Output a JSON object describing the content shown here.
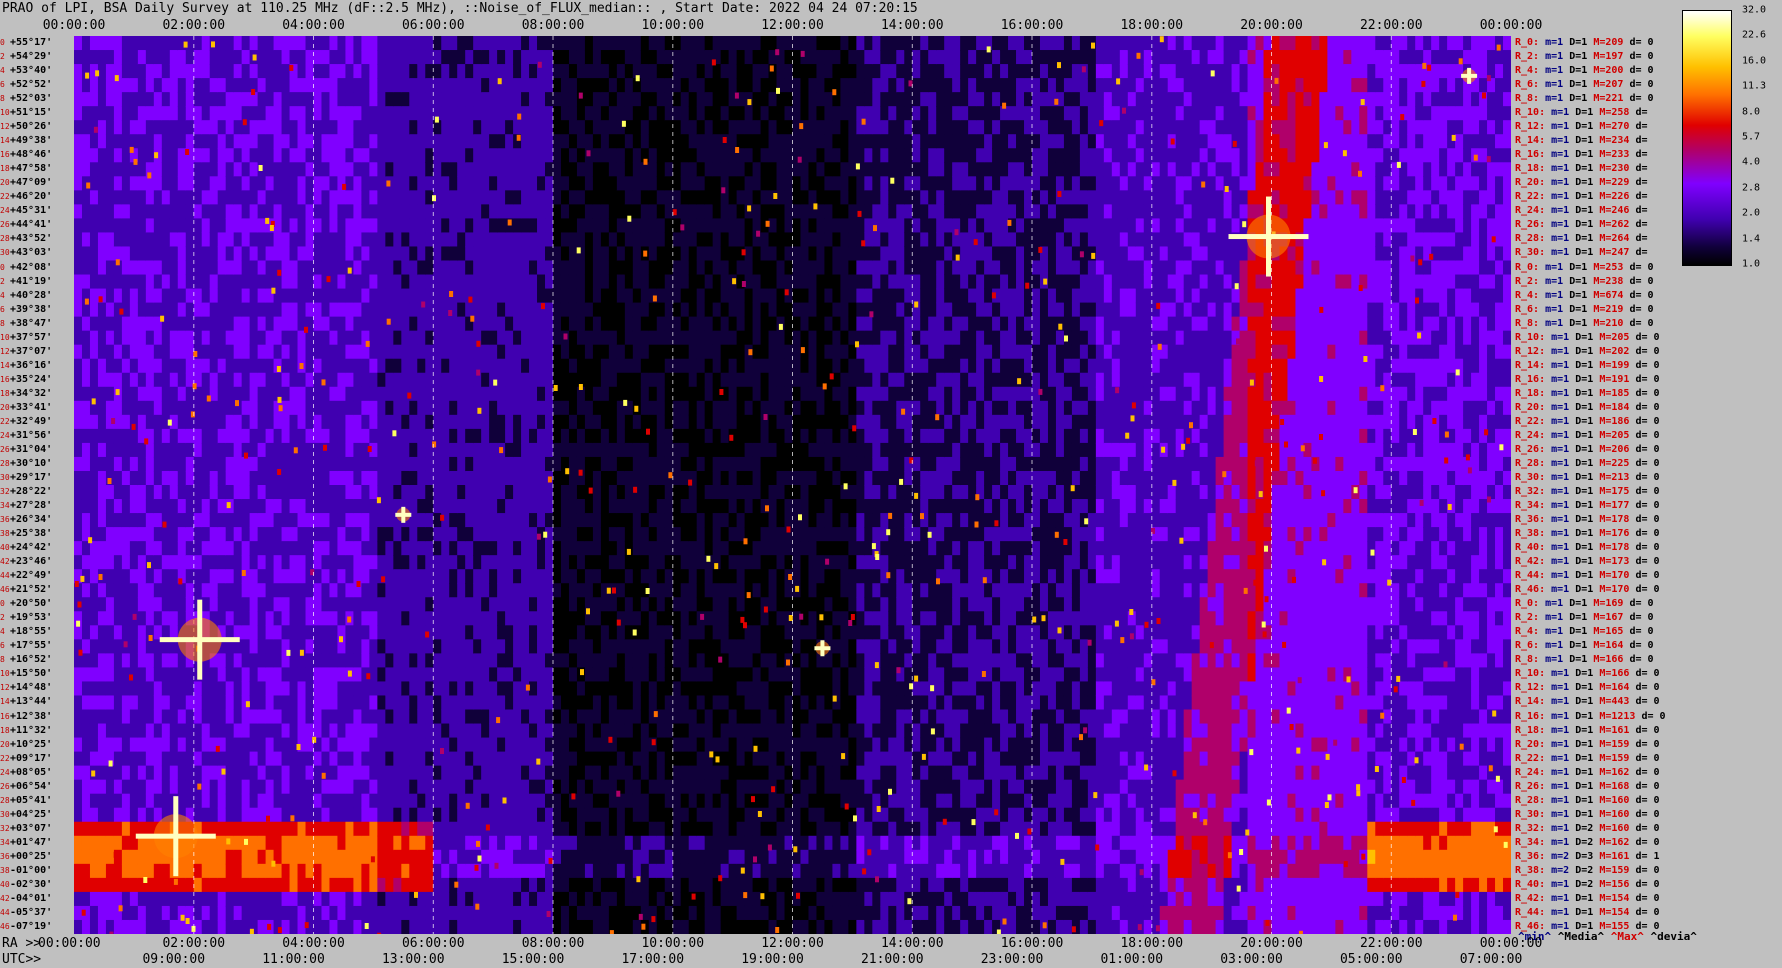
{
  "title": "PRAO of LPI, BSA Daily Survey at 110.25 MHz (dF::2.5 MHz), ::Noise_of_FLUX_median:: , Start Date: 2022 04 24 07:20:15",
  "top_axis_ticks": [
    "00:00:00",
    "02:00:00",
    "04:00:00",
    "06:00:00",
    "08:00:00",
    "10:00:00",
    "12:00:00",
    "14:00:00",
    "16:00:00",
    "18:00:00",
    "20:00:00",
    "22:00:00",
    "00:00:00"
  ],
  "bottom_ra": {
    "prefix": "RA >>",
    "ticks": [
      "00:00:00",
      "02:00:00",
      "04:00:00",
      "06:00:00",
      "08:00:00",
      "10:00:00",
      "12:00:00",
      "14:00:00",
      "16:00:00",
      "18:00:00",
      "20:00:00",
      "22:00:00",
      "00:00:00"
    ]
  },
  "bottom_utc": {
    "prefix": "UTC>>",
    "ticks": [
      "09:00:00",
      "11:00:00",
      "13:00:00",
      "15:00:00",
      "17:00:00",
      "19:00:00",
      "21:00:00",
      "23:00:00",
      "01:00:00",
      "03:00:00",
      "05:00:00",
      "07:00:00"
    ]
  },
  "declinations": [
    "+55°17'",
    "+54°29'",
    "+53°40'",
    "+52°52'",
    "+52°03'",
    "+51°15'",
    "+50°26'",
    "+49°38'",
    "+48°46'",
    "+47°58'",
    "+47°09'",
    "+46°20'",
    "+45°31'",
    "+44°41'",
    "+43°52'",
    "+43°03'",
    "+42°08'",
    "+41°19'",
    "+40°28'",
    "+39°38'",
    "+38°47'",
    "+37°57'",
    "+37°07'",
    "+36°16'",
    "+35°24'",
    "+34°32'",
    "+33°41'",
    "+32°49'",
    "+31°56'",
    "+31°04'",
    "+30°10'",
    "+29°17'",
    "+28°22'",
    "+27°28'",
    "+26°34'",
    "+25°38'",
    "+24°42'",
    "+23°46'",
    "+22°49'",
    "+21°52'",
    "+20°50'",
    "+19°53'",
    "+18°55'",
    "+17°55'",
    "+16°52'",
    "+15°50'",
    "+14°48'",
    "+13°44'",
    "+12°38'",
    "+11°32'",
    "+10°25'",
    "+09°17'",
    "+08°05'",
    "+06°54'",
    "+05°41'",
    "+04°25'",
    "+03°07'",
    "+01°47'",
    "+00°25'",
    "-01°00'",
    "-02°30'",
    "-04°01'",
    "-05°37'",
    "-07°19'"
  ],
  "dec_indices": [
    "0",
    "2",
    "4",
    "6",
    "8",
    "10",
    "12",
    "14",
    "16",
    "18",
    "20",
    "22",
    "24",
    "26",
    "28",
    "30",
    "0",
    "2",
    "4",
    "6",
    "8",
    "10",
    "12",
    "14",
    "16",
    "18",
    "20",
    "22",
    "24",
    "26",
    "28",
    "30",
    "32",
    "34",
    "36",
    "38",
    "40",
    "42",
    "44",
    "46",
    "0",
    "2",
    "4",
    "6",
    "8",
    "10",
    "12",
    "14",
    "16",
    "18",
    "20",
    "22",
    "24",
    "26",
    "28",
    "30",
    "32",
    "34",
    "36",
    "38",
    "40",
    "42",
    "44",
    "46"
  ],
  "stats": [
    {
      "r": "R_0:",
      "m": "m=1",
      "d": "D=1",
      "M": "M=209",
      "dd": "d= 0"
    },
    {
      "r": "R_2:",
      "m": "m=1",
      "d": "D=1",
      "M": "M=197",
      "dd": "d= 0"
    },
    {
      "r": "R_4:",
      "m": "m=1",
      "d": "D=1",
      "M": "M=200",
      "dd": "d= 0"
    },
    {
      "r": "R_6:",
      "m": "m=1",
      "d": "D=1",
      "M": "M=207",
      "dd": "d= 0"
    },
    {
      "r": "R_8:",
      "m": "m=1",
      "d": "D=1",
      "M": "M=221",
      "dd": "d= 0"
    },
    {
      "r": "R_10:",
      "m": "m=1",
      "d": "D=1",
      "M": "M=258",
      "dd": "d="
    },
    {
      "r": "R_12:",
      "m": "m=1",
      "d": "D=1",
      "M": "M=270",
      "dd": "d="
    },
    {
      "r": "R_14:",
      "m": "m=1",
      "d": "D=1",
      "M": "M=234",
      "dd": "d="
    },
    {
      "r": "R_16:",
      "m": "m=1",
      "d": "D=1",
      "M": "M=233",
      "dd": "d="
    },
    {
      "r": "R_18:",
      "m": "m=1",
      "d": "D=1",
      "M": "M=230",
      "dd": "d="
    },
    {
      "r": "R_20:",
      "m": "m=1",
      "d": "D=1",
      "M": "M=229",
      "dd": "d="
    },
    {
      "r": "R_22:",
      "m": "m=1",
      "d": "D=1",
      "M": "M=226",
      "dd": "d="
    },
    {
      "r": "R_24:",
      "m": "m=1",
      "d": "D=1",
      "M": "M=246",
      "dd": "d="
    },
    {
      "r": "R_26:",
      "m": "m=1",
      "d": "D=1",
      "M": "M=262",
      "dd": "d="
    },
    {
      "r": "R_28:",
      "m": "m=1",
      "d": "D=1",
      "M": "M=264",
      "dd": "d="
    },
    {
      "r": "R_30:",
      "m": "m=1",
      "d": "D=1",
      "M": "M=247",
      "dd": "d="
    },
    {
      "r": "R_0:",
      "m": "m=1",
      "d": "D=1",
      "M": "M=253",
      "dd": "d= 0"
    },
    {
      "r": "R_2:",
      "m": "m=1",
      "d": "D=1",
      "M": "M=238",
      "dd": "d= 0"
    },
    {
      "r": "R_4:",
      "m": "m=1",
      "d": "D=1",
      "M": "M=674",
      "dd": "d= 0"
    },
    {
      "r": "R_6:",
      "m": "m=1",
      "d": "D=1",
      "M": "M=219",
      "dd": "d= 0"
    },
    {
      "r": "R_8:",
      "m": "m=1",
      "d": "D=1",
      "M": "M=210",
      "dd": "d= 0"
    },
    {
      "r": "R_10:",
      "m": "m=1",
      "d": "D=1",
      "M": "M=205",
      "dd": "d= 0"
    },
    {
      "r": "R_12:",
      "m": "m=1",
      "d": "D=1",
      "M": "M=202",
      "dd": "d= 0"
    },
    {
      "r": "R_14:",
      "m": "m=1",
      "d": "D=1",
      "M": "M=199",
      "dd": "d= 0"
    },
    {
      "r": "R_16:",
      "m": "m=1",
      "d": "D=1",
      "M": "M=191",
      "dd": "d= 0"
    },
    {
      "r": "R_18:",
      "m": "m=1",
      "d": "D=1",
      "M": "M=185",
      "dd": "d= 0"
    },
    {
      "r": "R_20:",
      "m": "m=1",
      "d": "D=1",
      "M": "M=184",
      "dd": "d= 0"
    },
    {
      "r": "R_22:",
      "m": "m=1",
      "d": "D=1",
      "M": "M=186",
      "dd": "d= 0"
    },
    {
      "r": "R_24:",
      "m": "m=1",
      "d": "D=1",
      "M": "M=205",
      "dd": "d= 0"
    },
    {
      "r": "R_26:",
      "m": "m=1",
      "d": "D=1",
      "M": "M=206",
      "dd": "d= 0"
    },
    {
      "r": "R_28:",
      "m": "m=1",
      "d": "D=1",
      "M": "M=225",
      "dd": "d= 0"
    },
    {
      "r": "R_30:",
      "m": "m=1",
      "d": "D=1",
      "M": "M=213",
      "dd": "d= 0"
    },
    {
      "r": "R_32:",
      "m": "m=1",
      "d": "D=1",
      "M": "M=175",
      "dd": "d= 0"
    },
    {
      "r": "R_34:",
      "m": "m=1",
      "d": "D=1",
      "M": "M=177",
      "dd": "d= 0"
    },
    {
      "r": "R_36:",
      "m": "m=1",
      "d": "D=1",
      "M": "M=178",
      "dd": "d= 0"
    },
    {
      "r": "R_38:",
      "m": "m=1",
      "d": "D=1",
      "M": "M=176",
      "dd": "d= 0"
    },
    {
      "r": "R_40:",
      "m": "m=1",
      "d": "D=1",
      "M": "M=178",
      "dd": "d= 0"
    },
    {
      "r": "R_42:",
      "m": "m=1",
      "d": "D=1",
      "M": "M=173",
      "dd": "d= 0"
    },
    {
      "r": "R_44:",
      "m": "m=1",
      "d": "D=1",
      "M": "M=170",
      "dd": "d= 0"
    },
    {
      "r": "R_46:",
      "m": "m=1",
      "d": "D=1",
      "M": "M=170",
      "dd": "d= 0"
    },
    {
      "r": "R_0:",
      "m": "m=1",
      "d": "D=1",
      "M": "M=169",
      "dd": "d= 0"
    },
    {
      "r": "R_2:",
      "m": "m=1",
      "d": "D=1",
      "M": "M=167",
      "dd": "d= 0"
    },
    {
      "r": "R_4:",
      "m": "m=1",
      "d": "D=1",
      "M": "M=165",
      "dd": "d= 0"
    },
    {
      "r": "R_6:",
      "m": "m=1",
      "d": "D=1",
      "M": "M=164",
      "dd": "d= 0"
    },
    {
      "r": "R_8:",
      "m": "m=1",
      "d": "D=1",
      "M": "M=166",
      "dd": "d= 0"
    },
    {
      "r": "R_10:",
      "m": "m=1",
      "d": "D=1",
      "M": "M=166",
      "dd": "d= 0"
    },
    {
      "r": "R_12:",
      "m": "m=1",
      "d": "D=1",
      "M": "M=164",
      "dd": "d= 0"
    },
    {
      "r": "R_14:",
      "m": "m=1",
      "d": "D=1",
      "M": "M=443",
      "dd": "d= 0"
    },
    {
      "r": "R_16:",
      "m": "m=1",
      "d": "D=1",
      "M": "M=1213",
      "dd": "d= 0"
    },
    {
      "r": "R_18:",
      "m": "m=1",
      "d": "D=1",
      "M": "M=161",
      "dd": "d= 0"
    },
    {
      "r": "R_20:",
      "m": "m=1",
      "d": "D=1",
      "M": "M=159",
      "dd": "d= 0"
    },
    {
      "r": "R_22:",
      "m": "m=1",
      "d": "D=1",
      "M": "M=159",
      "dd": "d= 0"
    },
    {
      "r": "R_24:",
      "m": "m=1",
      "d": "D=1",
      "M": "M=162",
      "dd": "d= 0"
    },
    {
      "r": "R_26:",
      "m": "m=1",
      "d": "D=1",
      "M": "M=168",
      "dd": "d= 0"
    },
    {
      "r": "R_28:",
      "m": "m=1",
      "d": "D=1",
      "M": "M=160",
      "dd": "d= 0"
    },
    {
      "r": "R_30:",
      "m": "m=1",
      "d": "D=1",
      "M": "M=160",
      "dd": "d= 0"
    },
    {
      "r": "R_32:",
      "m": "m=1",
      "d": "D=2",
      "M": "M=160",
      "dd": "d= 0"
    },
    {
      "r": "R_34:",
      "m": "m=1",
      "d": "D=2",
      "M": "M=162",
      "dd": "d= 0"
    },
    {
      "r": "R_36:",
      "m": "m=2",
      "d": "D=3",
      "M": "M=161",
      "dd": "d= 1"
    },
    {
      "r": "R_38:",
      "m": "m=2",
      "d": "D=2",
      "M": "M=159",
      "dd": "d= 0"
    },
    {
      "r": "R_40:",
      "m": "m=1",
      "d": "D=2",
      "M": "M=156",
      "dd": "d= 0"
    },
    {
      "r": "R_42:",
      "m": "m=1",
      "d": "D=1",
      "M": "M=154",
      "dd": "d= 0"
    },
    {
      "r": "R_44:",
      "m": "m=1",
      "d": "D=1",
      "M": "M=154",
      "dd": "d= 0"
    },
    {
      "r": "R_46:",
      "m": "m=1",
      "d": "D=1",
      "M": "M=155",
      "dd": "d= 0"
    }
  ],
  "legend_footer": {
    "min": "^min^",
    "med": "^Media^",
    "max": "^Max^",
    "dev": "^devia^"
  },
  "colorbar": {
    "ticks": [
      "32.0",
      "22.6",
      "16.0",
      "11.3",
      "8.0",
      "5.7",
      "4.0",
      "2.8",
      "2.0",
      "1.4",
      "1.0"
    ]
  },
  "colors": {
    "background": "#c0c0c0",
    "plot_bg": "#000000",
    "label_red": "#d00000",
    "label_navy": "#000080"
  },
  "chart_data": {
    "type": "heatmap",
    "title": "PRAO of LPI, BSA Daily Survey at 110.25 MHz (dF::2.5 MHz), ::Noise_of_FLUX_median:: , Start Date: 2022 04 24 07:20:15",
    "x_axis": "RA (hh:mm:ss), 00:00:00 to 24:00:00",
    "y_axis": "Declination, +55°17' to -07°19'",
    "value_range": [
      1.0,
      32.0
    ],
    "colormap": [
      "#000000",
      "#10003a",
      "#4000b0",
      "#8000ff",
      "#b0006a",
      "#e00000",
      "#ff7000",
      "#ffc000",
      "#ffff60",
      "#ffffff"
    ],
    "bright_sources": [
      {
        "ra_h": 2.1,
        "dec": 13.2,
        "value": 32
      },
      {
        "ra_h": 19.95,
        "dec": 41.3,
        "value": 32
      },
      {
        "ra_h": 1.7,
        "dec": -0.5,
        "value": 32
      },
      {
        "ra_h": 23.3,
        "dec": 52.5,
        "value": 16
      },
      {
        "ra_h": 12.5,
        "dec": 12.6,
        "value": 16
      },
      {
        "ra_h": 5.5,
        "dec": 21.9,
        "value": 16
      }
    ]
  }
}
